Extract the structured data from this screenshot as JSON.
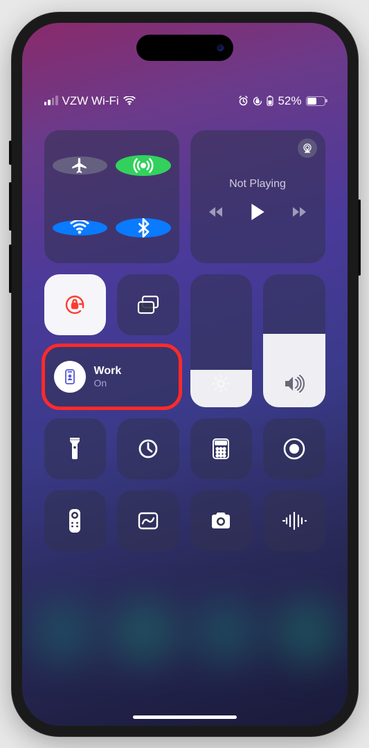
{
  "status": {
    "carrier": "VZW Wi-Fi",
    "battery_pct": "52%"
  },
  "media": {
    "title": "Not Playing"
  },
  "focus": {
    "name": "Work",
    "state": "On"
  }
}
